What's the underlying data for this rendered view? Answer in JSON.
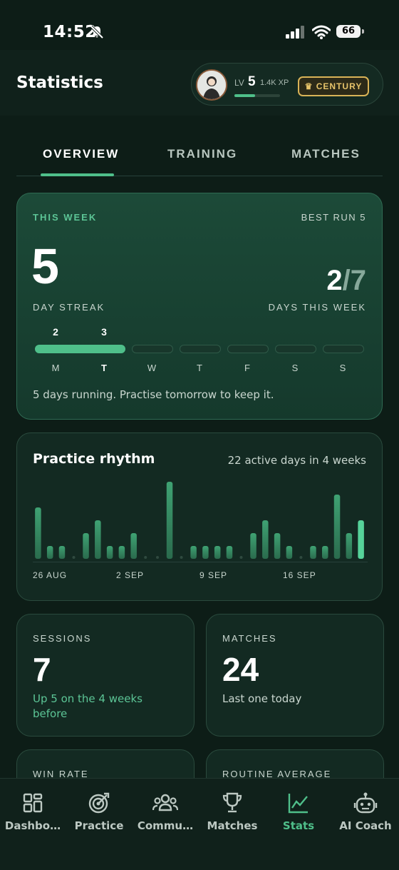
{
  "status_bar": {
    "time": "14:52",
    "battery": "66"
  },
  "header": {
    "title": "Statistics",
    "level_prefix": "LV",
    "level": "5",
    "xp": "1.4K XP",
    "xp_progress": 0.45,
    "badge": "CENTURY"
  },
  "tabs": [
    {
      "label": "OVERVIEW",
      "active": true
    },
    {
      "label": "TRAINING",
      "active": false
    },
    {
      "label": "MATCHES",
      "active": false
    }
  ],
  "week_card": {
    "label": "THIS WEEK",
    "best_run": "BEST RUN 5",
    "streak": "5",
    "streak_label": "DAY STREAK",
    "days_done": "2",
    "days_total": "/7",
    "days_label": "DAYS THIS WEEK",
    "day_counts": [
      "2",
      "3"
    ],
    "days": [
      "M",
      "T",
      "W",
      "T",
      "F",
      "S",
      "S"
    ],
    "current_day_index": 1,
    "filled_days": 2,
    "message": "5 days running. Practise tomorrow to keep it."
  },
  "rhythm": {
    "title": "Practice rhythm",
    "subtitle": "22 active days in 4 weeks",
    "x_labels": [
      "26 AUG",
      "2 SEP",
      "9 SEP",
      "16 SEP"
    ],
    "values": [
      4,
      1,
      1,
      0,
      2,
      3,
      1,
      1,
      2,
      0,
      0,
      6,
      0,
      1,
      1,
      1,
      1,
      0,
      2,
      3,
      2,
      1,
      0,
      1,
      1,
      5,
      2,
      3
    ],
    "colors": {
      "bar_top": "#3fa273",
      "bar_bottom": "#2a6b4d",
      "highlight": "#56d39a"
    }
  },
  "sessions": {
    "label": "SESSIONS",
    "value": "7",
    "detail": "Up 5 on the 4 weeks before"
  },
  "matches": {
    "label": "MATCHES",
    "value": "24",
    "detail": "Last one today"
  },
  "win_rate": {
    "label": "WIN RATE"
  },
  "routine": {
    "label": "ROUTINE AVERAGE"
  },
  "nav": [
    {
      "label": "Dashbo…",
      "icon": "dashboard-icon",
      "active": false
    },
    {
      "label": "Practice",
      "icon": "target-icon",
      "active": false
    },
    {
      "label": "Commu…",
      "icon": "community-icon",
      "active": false
    },
    {
      "label": "Matches",
      "icon": "trophy-icon",
      "active": false
    },
    {
      "label": "Stats",
      "icon": "chart-icon",
      "active": true
    },
    {
      "label": "AI Coach",
      "icon": "robot-icon",
      "active": false
    }
  ],
  "colors": {
    "accent": "#4fbf8a",
    "background": "#0d1d17",
    "badge_gold": "#e6c36a"
  }
}
